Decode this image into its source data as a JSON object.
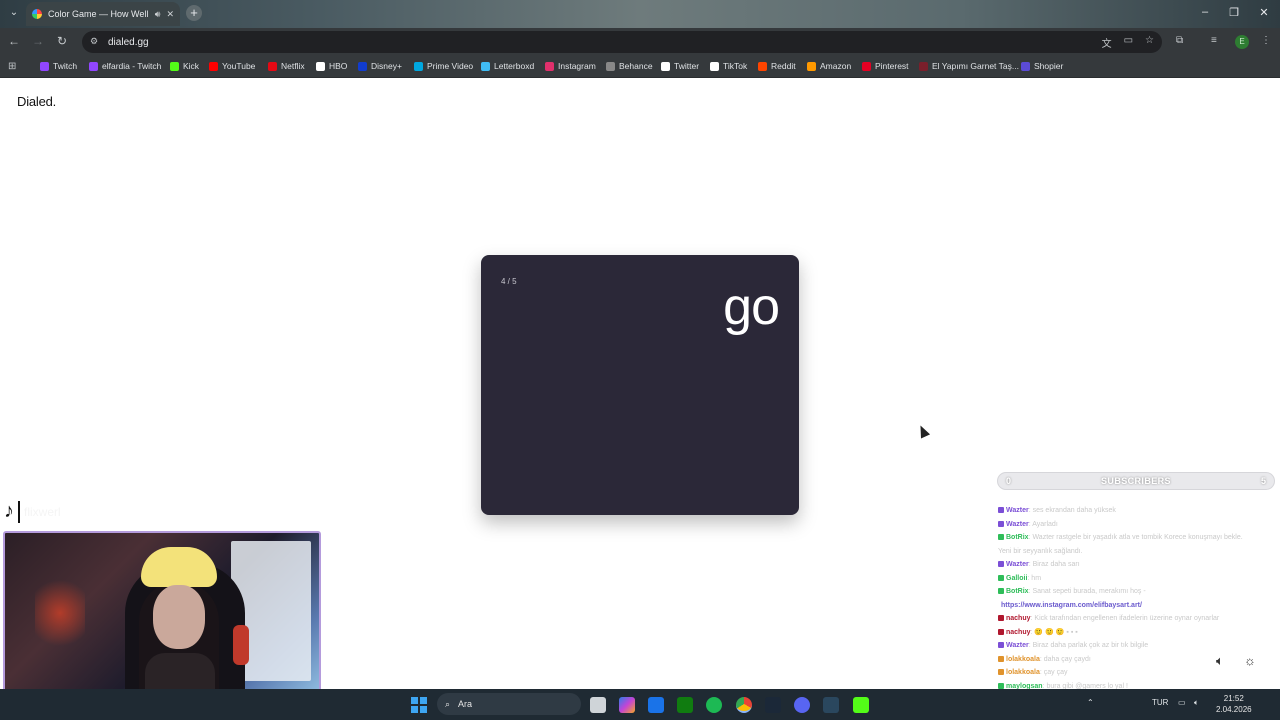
{
  "browser": {
    "tab_title": "Color Game — How Well C",
    "url": "dialed.gg",
    "bookmarks": [
      {
        "label": "Twitch",
        "color": "#9146ff"
      },
      {
        "label": "elfardia - Twitch",
        "color": "#9146ff"
      },
      {
        "label": "Kick",
        "color": "#53fc18"
      },
      {
        "label": "YouTube",
        "color": "#ff0000"
      },
      {
        "label": "Netflix",
        "color": "#e50914"
      },
      {
        "label": "HBO",
        "color": "#ffffff"
      },
      {
        "label": "Disney+",
        "color": "#113ccf"
      },
      {
        "label": "Prime Video",
        "color": "#00a8e1"
      },
      {
        "label": "Letterboxd",
        "color": "#40bcf4"
      },
      {
        "label": "Instagram",
        "color": "#e1306c"
      },
      {
        "label": "Behance",
        "color": "#888888"
      },
      {
        "label": "Twitter",
        "color": "#ffffff"
      },
      {
        "label": "TikTok",
        "color": "#ffffff"
      },
      {
        "label": "Reddit",
        "color": "#ff4500"
      },
      {
        "label": "Amazon",
        "color": "#ff9900"
      },
      {
        "label": "Pinterest",
        "color": "#e60023"
      },
      {
        "label": "El Yapımı Garnet Taş...",
        "color": "#7a1f2b"
      },
      {
        "label": "Shopier",
        "color": "#5b4bd6"
      }
    ]
  },
  "page": {
    "logo": "Dialed.",
    "card": {
      "progress": "4 / 5",
      "word": "go",
      "background": "#2b2838"
    }
  },
  "overlay": {
    "tiktok_name": "flixwerl",
    "subscribers": {
      "left": "0",
      "label": "SUBSCRIBERS",
      "right": "5"
    },
    "chat": [
      {
        "user": "Wazter",
        "user_color": "#7b4fd6",
        "text": ": ses ekrandan daha yüksek"
      },
      {
        "user": "Wazter",
        "user_color": "#7b4fd6",
        "text": ": Ayarladı"
      },
      {
        "user": "BotRix",
        "user_color": "#2ebd59",
        "text": ": Wazter rastgele bir yaşadık atla ve tombik Korece konuşmayı bekle."
      },
      {
        "user": "",
        "user_color": "#c9c9c9",
        "text": "Yeni bir seyyanlık sağlandı."
      },
      {
        "user": "Wazter",
        "user_color": "#7b4fd6",
        "text": ": Biraz daha sarı"
      },
      {
        "user": "Galloii",
        "user_color": "#2ebd59",
        "text": ": hm"
      },
      {
        "user": "BotRix",
        "user_color": "#2ebd59",
        "text": ": Sanat sepeti burada, merakımı hoş -"
      },
      {
        "user": "",
        "user_color": "#6a5acd",
        "link": "https://www.instagram.com/elifbaysart.art/",
        "text": ""
      },
      {
        "user": "nachuy",
        "user_color": "#b0172e",
        "text": ": Kick tarafından engellenen ifadelerin üzerine oynar oynarlar"
      },
      {
        "user": "nachuy",
        "user_color": "#b0172e",
        "text": ": 🙂 🙂 🙂 ▪ ▪ ▪"
      },
      {
        "user": "Wazter",
        "user_color": "#7b4fd6",
        "text": ": Biraz daha parlak çok az bir tık bilgile"
      },
      {
        "user": "lolakkoala",
        "user_color": "#e0932c",
        "text": ": daha çay çaydı"
      },
      {
        "user": "lolakkoala",
        "user_color": "#e0932c",
        "text": ": çay çay"
      },
      {
        "user": "maylogsan",
        "user_color": "#2ebd59",
        "text": ": bura gibi @gamers lo yal !"
      },
      {
        "user": "BotRix",
        "user_color": "#2ebd59",
        "text": ": Gel la",
        "link": "https://discord.gg/n7ketysDR4"
      },
      {
        "user": "nachuy",
        "user_color": "#b0172e",
        "text": ": Ne bu olm"
      }
    ]
  },
  "taskbar": {
    "search_placeholder": "Ara",
    "language": "TUR",
    "time": "21:52",
    "date": "2.04.2026"
  }
}
